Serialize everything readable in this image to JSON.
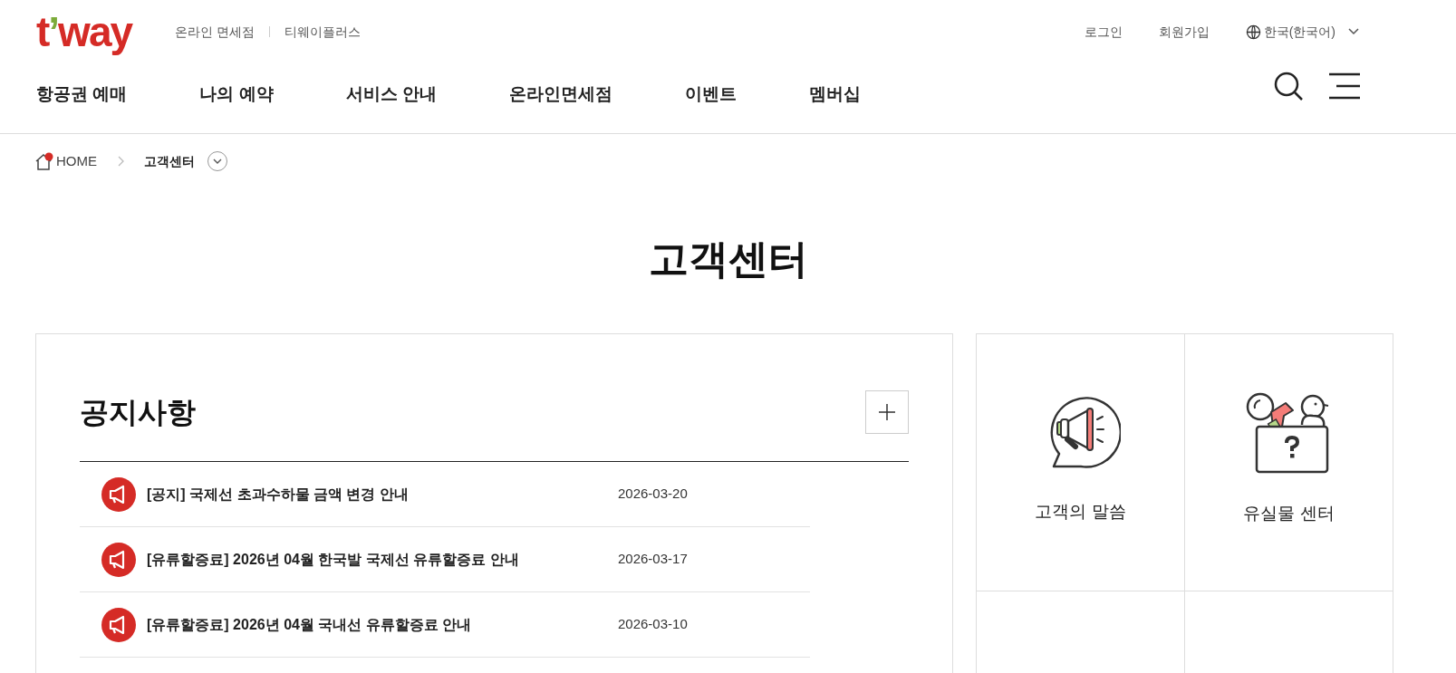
{
  "logo": {
    "text": "t’way"
  },
  "top_links": [
    "온라인 면세점",
    "티웨이플러스"
  ],
  "account_links": [
    "로그인",
    "회원가입"
  ],
  "language": {
    "label": "한국(한국어)"
  },
  "nav": [
    "항공권 예매",
    "나의 예약",
    "서비스 안내",
    "온라인면세점",
    "이벤트",
    "멤버십"
  ],
  "breadcrumb": {
    "home": "HOME",
    "current": "고객센터"
  },
  "page_title": "고객센터",
  "notices": {
    "title": "공지사항",
    "items": [
      {
        "title": "[공지] 국제선 초과수하물 금액 변경 안내",
        "date": "2026-03-20"
      },
      {
        "title": "[유류할증료] 2026년 04월 한국발 국제선 유류할증료 안내",
        "date": "2026-03-17"
      },
      {
        "title": "[유류할증료] 2026년 04월 국내선 유류할증료 안내",
        "date": "2026-03-10"
      }
    ]
  },
  "quick_menu": [
    {
      "kind": "megaphone",
      "label": "고객의 말씀"
    },
    {
      "kind": "lostbox",
      "label": "유실물 센터"
    },
    {
      "kind": "blank"
    },
    {
      "kind": "blank"
    }
  ]
}
